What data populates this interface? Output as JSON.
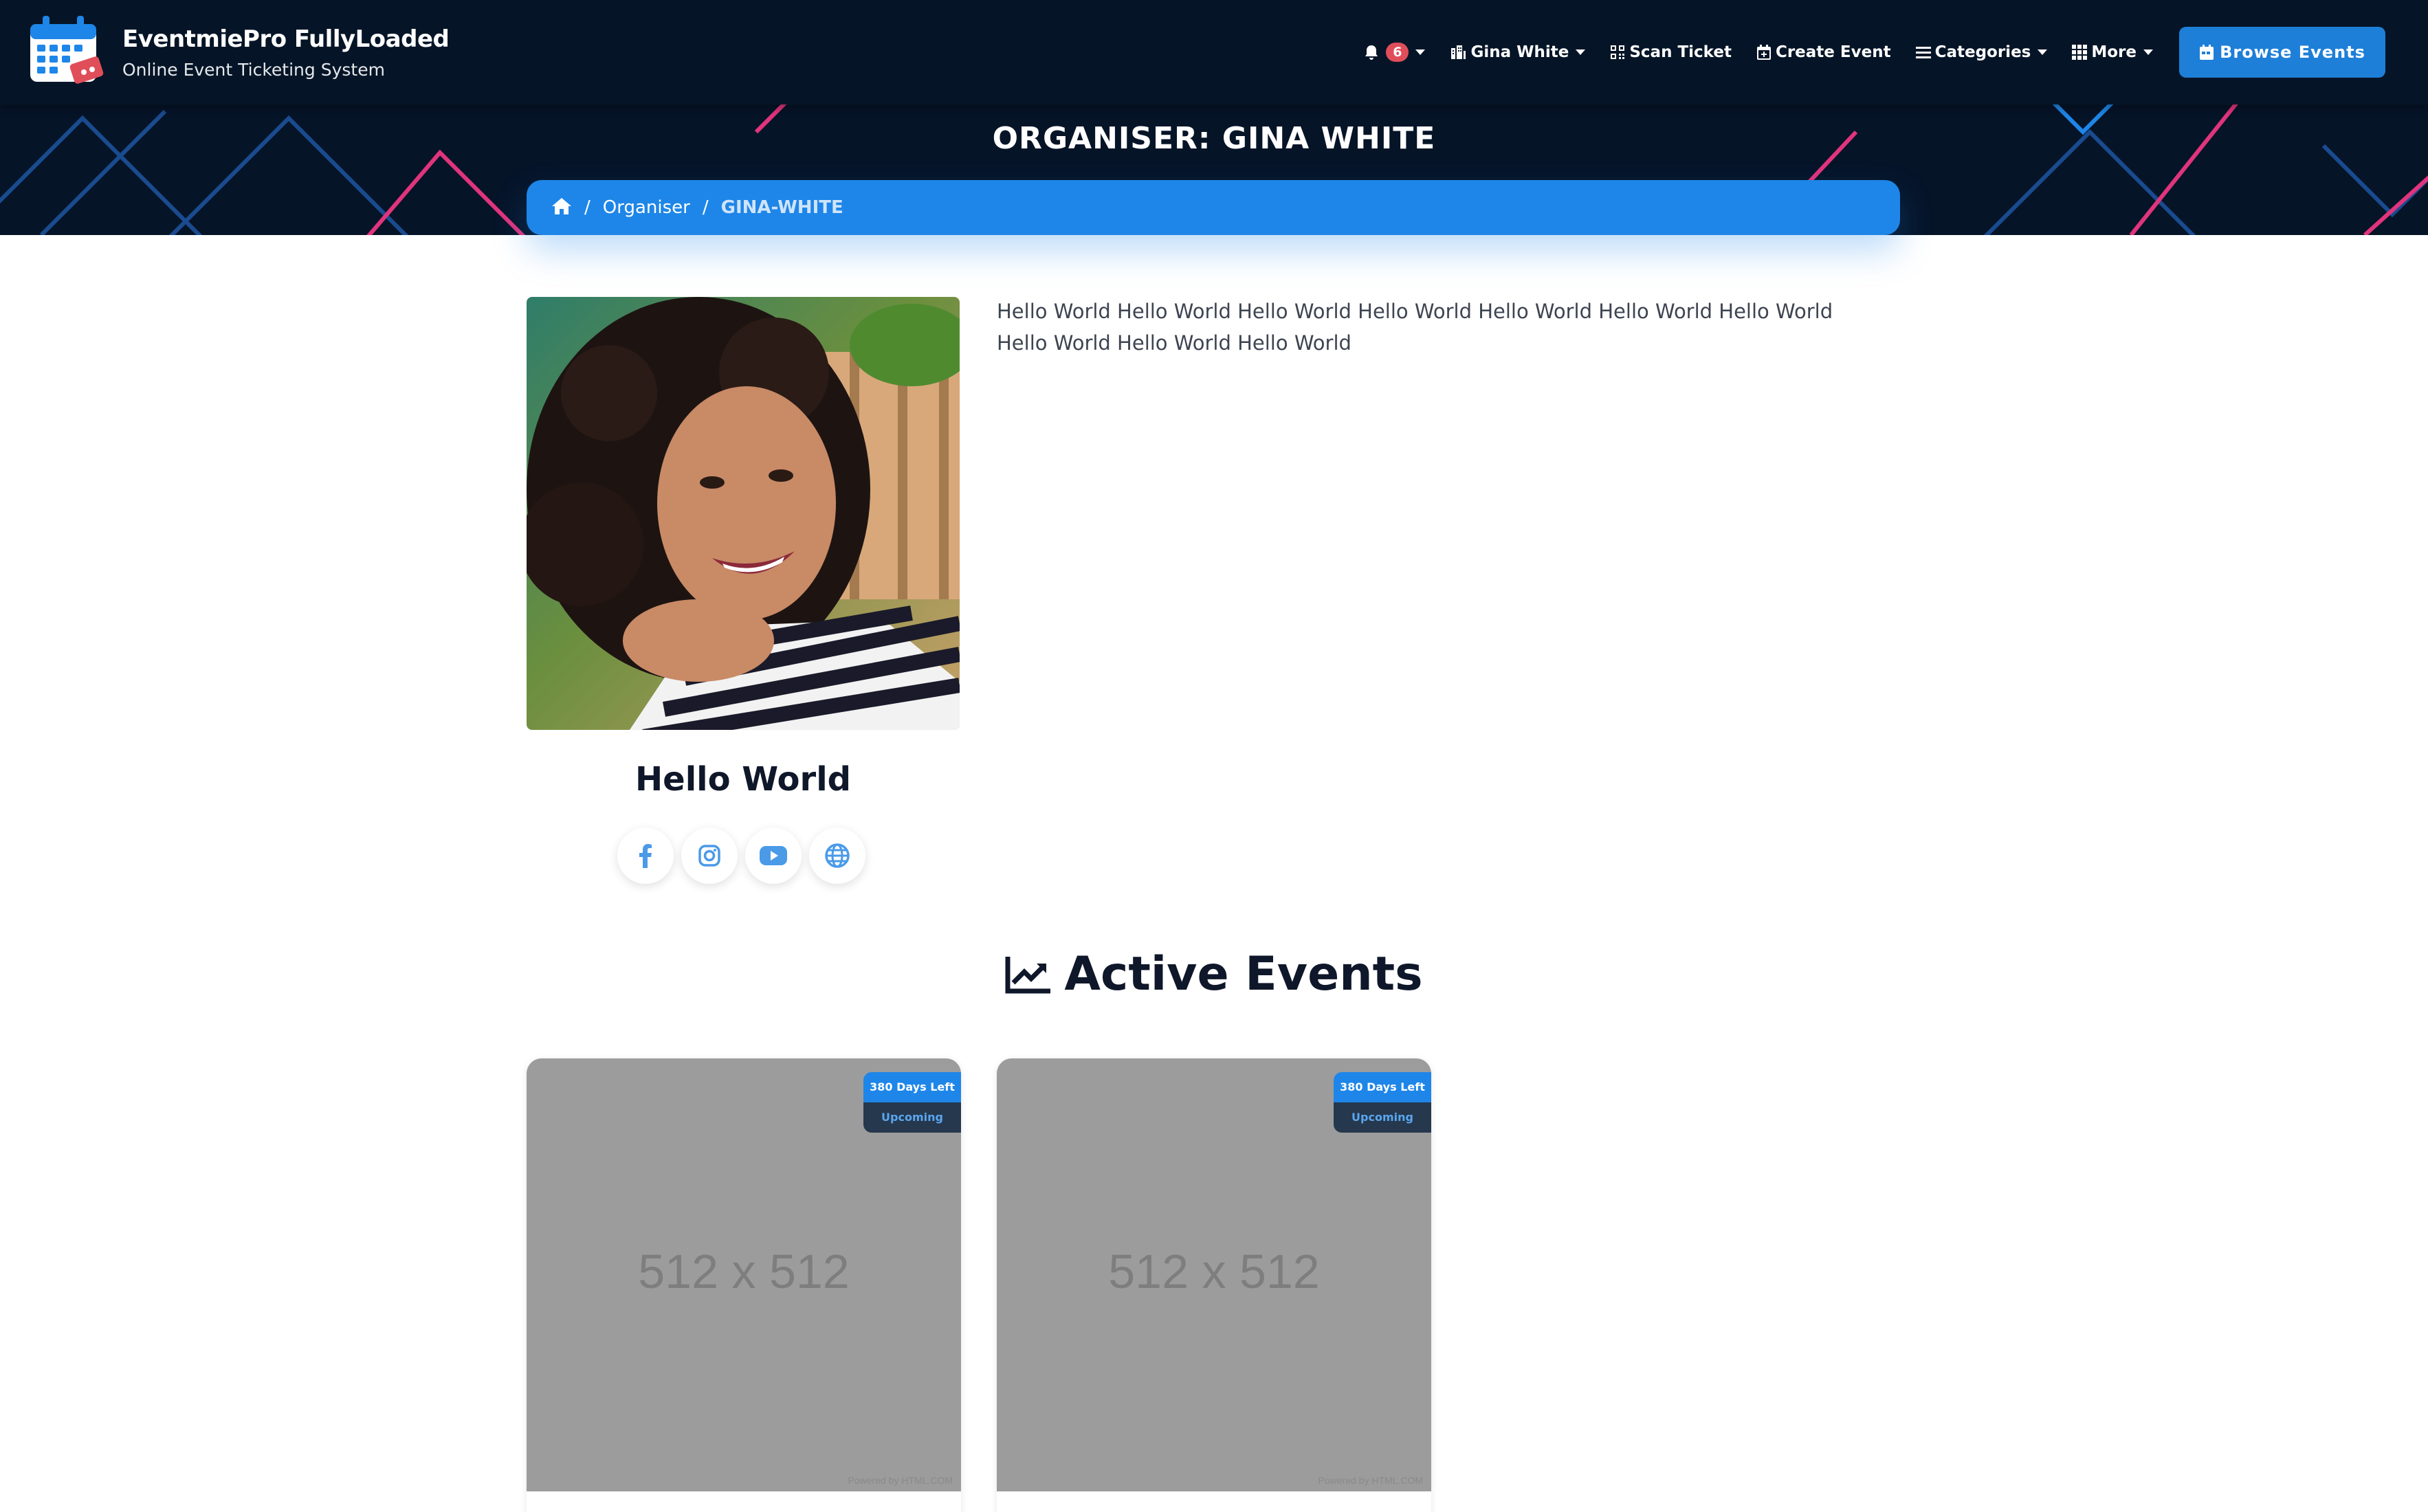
{
  "brand": {
    "title": "EventmiePro FullyLoaded",
    "subtitle": "Online Event Ticketing System"
  },
  "nav": {
    "notification_count": "6",
    "user_name": "Gina White",
    "scan_ticket": "Scan Ticket",
    "create_event": "Create Event",
    "categories": "Categories",
    "more": "More",
    "browse_events": "Browse Events"
  },
  "banner": {
    "title": "ORGANISER: GINA WHITE"
  },
  "breadcrumb": {
    "items": [
      "Organiser",
      "GINA-WHITE"
    ]
  },
  "profile": {
    "name": "Hello World",
    "bio": "Hello World Hello World Hello World Hello World Hello World Hello World Hello World Hello World Hello World Hello World",
    "socials": [
      "facebook-icon",
      "instagram-icon",
      "youtube-icon",
      "globe-icon"
    ]
  },
  "events_section": {
    "title": "Active Events",
    "events": [
      {
        "image_label": "512 x 512",
        "powered": "Powered by HTML.COM",
        "days_left": "380 Days Left",
        "status": "Upcoming"
      },
      {
        "image_label": "512 x 512",
        "powered": "Powered by HTML.COM",
        "days_left": "380 Days Left",
        "status": "Upcoming"
      }
    ]
  },
  "colors": {
    "navbar": "#051527",
    "primary": "#1e86e8",
    "badge": "#e04e5a",
    "accent_pink": "#e0347c"
  }
}
